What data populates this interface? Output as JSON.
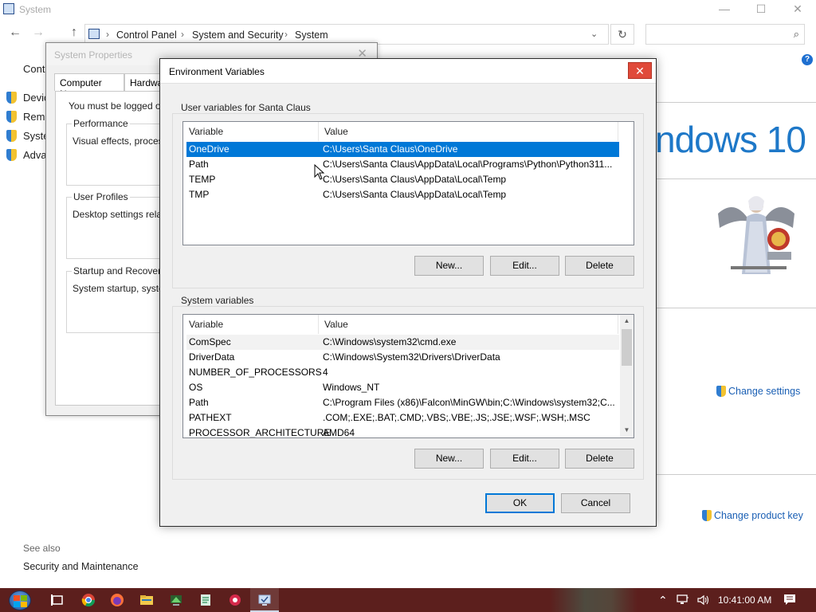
{
  "system_window": {
    "title": "System",
    "minimize": "—",
    "maximize": "☐",
    "close": "✕",
    "back_icon": "←",
    "forward_icon": "→",
    "up_icon": "↑",
    "breadcrumb": [
      "Control Panel",
      "System and Security",
      "System"
    ],
    "crumb_sep": "›",
    "dropdown_icon": "⌄",
    "refresh_icon": "↻",
    "search_icon": "⌕",
    "help_icon": "?",
    "cp_home_partial": "Cont",
    "sidebar_links": [
      "Devic",
      "Remo",
      "Syste",
      "Adva"
    ],
    "brand_text": "ndows 10",
    "change_settings": "Change settings",
    "change_product_key": "Change product key",
    "see_also": "See also",
    "security_maintenance": "Security and Maintenance"
  },
  "system_properties": {
    "title": "System Properties",
    "close": "✕",
    "tabs": [
      "Computer Name",
      "Hardwa"
    ],
    "logged_on_note": "You must be logged on a",
    "performance": {
      "title": "Performance",
      "desc": "Visual effects, processo"
    },
    "user_profiles": {
      "title": "User Profiles",
      "desc": "Desktop settings related"
    },
    "startup_recovery": {
      "title": "Startup and Recovery",
      "desc": "System startup, system"
    }
  },
  "env_dialog": {
    "title": "Environment Variables",
    "close": "✕",
    "user_section_label": "User variables for Santa Claus",
    "system_section_label": "System variables",
    "col_variable": "Variable",
    "col_value": "Value",
    "user_vars": [
      {
        "name": "OneDrive",
        "value": "C:\\Users\\Santa Claus\\OneDrive",
        "selected": true
      },
      {
        "name": "Path",
        "value": "C:\\Users\\Santa Claus\\AppData\\Local\\Programs\\Python\\Python311...",
        "selected": false
      },
      {
        "name": "TEMP",
        "value": "C:\\Users\\Santa Claus\\AppData\\Local\\Temp",
        "selected": false
      },
      {
        "name": "TMP",
        "value": "C:\\Users\\Santa Claus\\AppData\\Local\\Temp",
        "selected": false
      }
    ],
    "system_vars": [
      {
        "name": "ComSpec",
        "value": "C:\\Windows\\system32\\cmd.exe"
      },
      {
        "name": "DriverData",
        "value": "C:\\Windows\\System32\\Drivers\\DriverData"
      },
      {
        "name": "NUMBER_OF_PROCESSORS",
        "value": "4"
      },
      {
        "name": "OS",
        "value": "Windows_NT"
      },
      {
        "name": "Path",
        "value": "C:\\Program Files (x86)\\Falcon\\MinGW\\bin;C:\\Windows\\system32;C..."
      },
      {
        "name": "PATHEXT",
        "value": ".COM;.EXE;.BAT;.CMD;.VBS;.VBE;.JS;.JSE;.WSF;.WSH;.MSC"
      },
      {
        "name": "PROCESSOR_ARCHITECTURE",
        "value": "AMD64"
      }
    ],
    "new_label": "New...",
    "edit_label": "Edit...",
    "delete_label": "Delete",
    "ok_label": "OK",
    "cancel_label": "Cancel",
    "scroll_up": "▲",
    "scroll_down": "▼"
  },
  "taskbar": {
    "apps": [
      "task-view-icon",
      "chrome-icon",
      "firefox-icon",
      "file-explorer-icon",
      "network-app-icon",
      "notepad-icon",
      "app-icon-red",
      "system-window-icon"
    ],
    "tray_up": "⌃",
    "clock": "10:41:00 AM",
    "notification_icon": "▤"
  }
}
